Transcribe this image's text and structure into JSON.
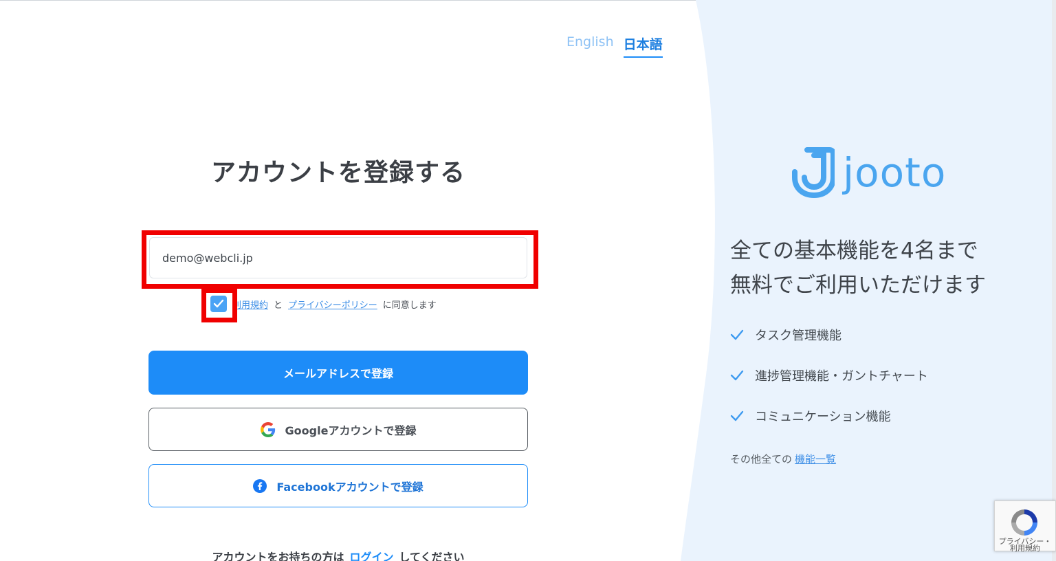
{
  "language": {
    "english": "English",
    "japanese": "日本語"
  },
  "form": {
    "title": "アカウントを登録する",
    "email_value": "demo@webcli.jp",
    "consent": {
      "terms_link": "利用規約",
      "and": "と",
      "privacy_link": "プライバシーポリシー",
      "suffix": "に同意します",
      "checked": true
    },
    "buttons": {
      "email": "メールアドレスで登録",
      "google": "Googleアカウントで登録",
      "facebook": "Facebookアカウントで登録"
    },
    "login_prompt": {
      "prefix": "アカウントをお持ちの方は",
      "link": "ログイン",
      "suffix": "してください"
    }
  },
  "promo": {
    "brand": "jooto",
    "tagline_line1": "全ての基本機能を4名まで",
    "tagline_line2": "無料でご利用いただけます",
    "features": [
      "タスク管理機能",
      "進捗管理機能・ガントチャート",
      "コミュニケーション機能"
    ],
    "others_prefix": "その他全ての",
    "others_link": "機能一覧"
  },
  "recaptcha": {
    "privacy": "プライバシー・",
    "terms": "利用規約"
  },
  "colors": {
    "primary": "#1d8cf8",
    "highlight": "#f00000",
    "panel_bg": "#eaf3fd",
    "logo": "#4aa5ef"
  }
}
